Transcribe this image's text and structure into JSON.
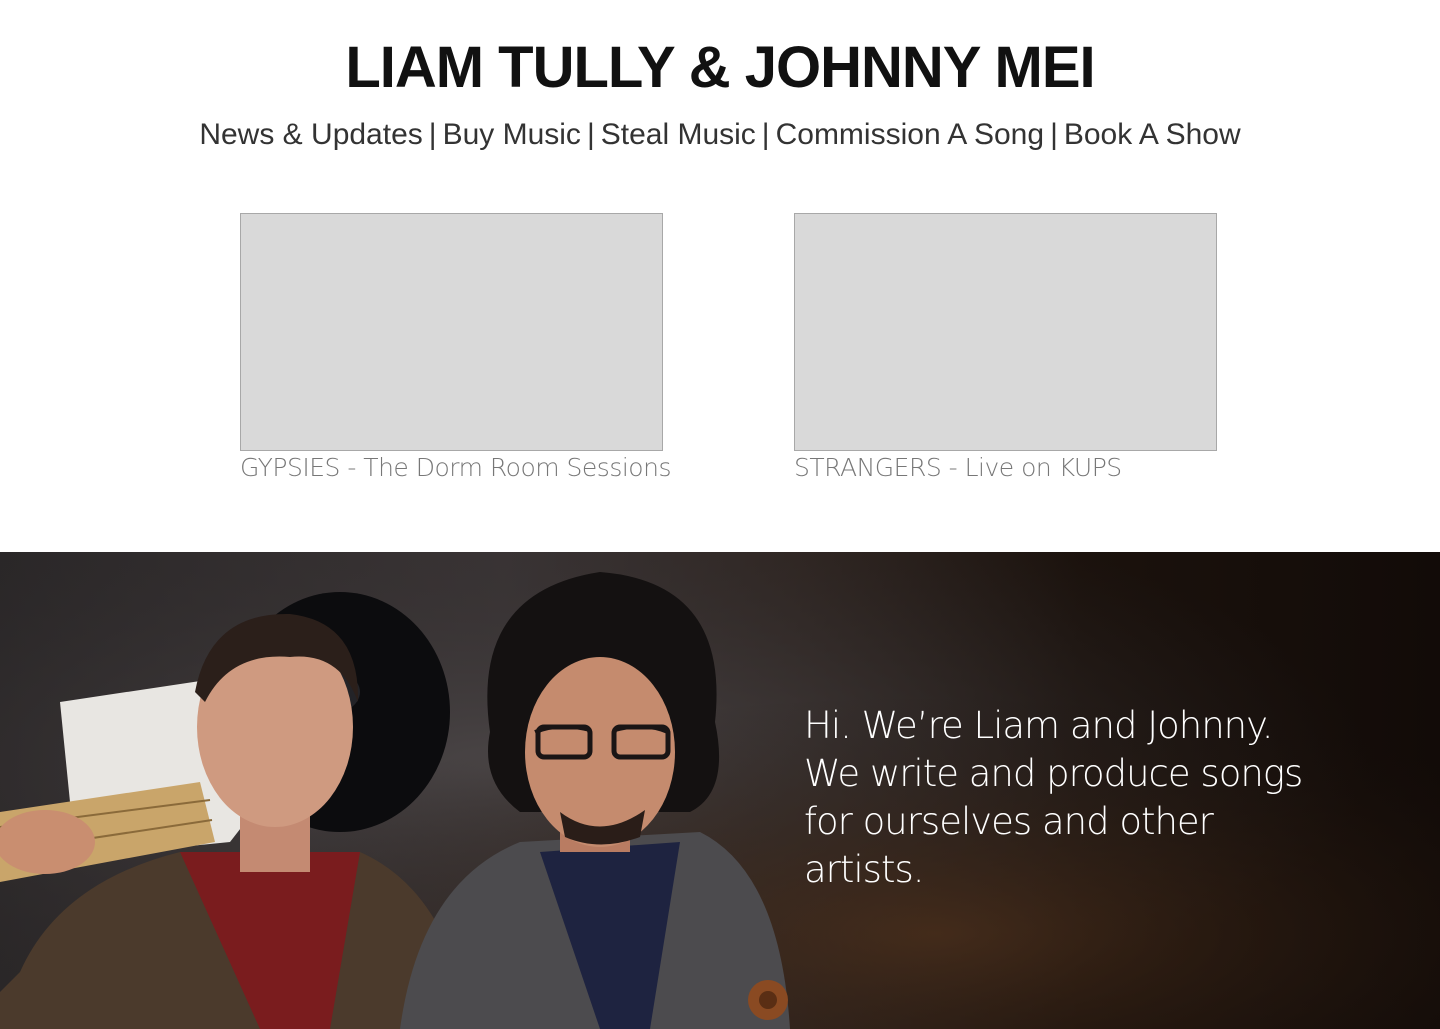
{
  "site": {
    "title": "LIAM TULLY & JOHNNY MEI"
  },
  "nav": {
    "items": [
      {
        "label": "News & Updates"
      },
      {
        "label": "Buy Music"
      },
      {
        "label": "Steal Music"
      },
      {
        "label": "Commission A Song"
      },
      {
        "label": "Book A Show"
      }
    ],
    "separator": "|"
  },
  "videos": [
    {
      "caption": "GYPSIES - The Dorm Room Sessions"
    },
    {
      "caption": "STRANGERS - Live on KUPS"
    }
  ],
  "hero": {
    "intro": "Hi. We’re Liam and Johnny. We write and produce songs for ourselves and other artists."
  },
  "colors": {
    "video_placeholder": "#d9d9d9",
    "caption_text": "#777777",
    "hero_background": "#1b120d"
  }
}
